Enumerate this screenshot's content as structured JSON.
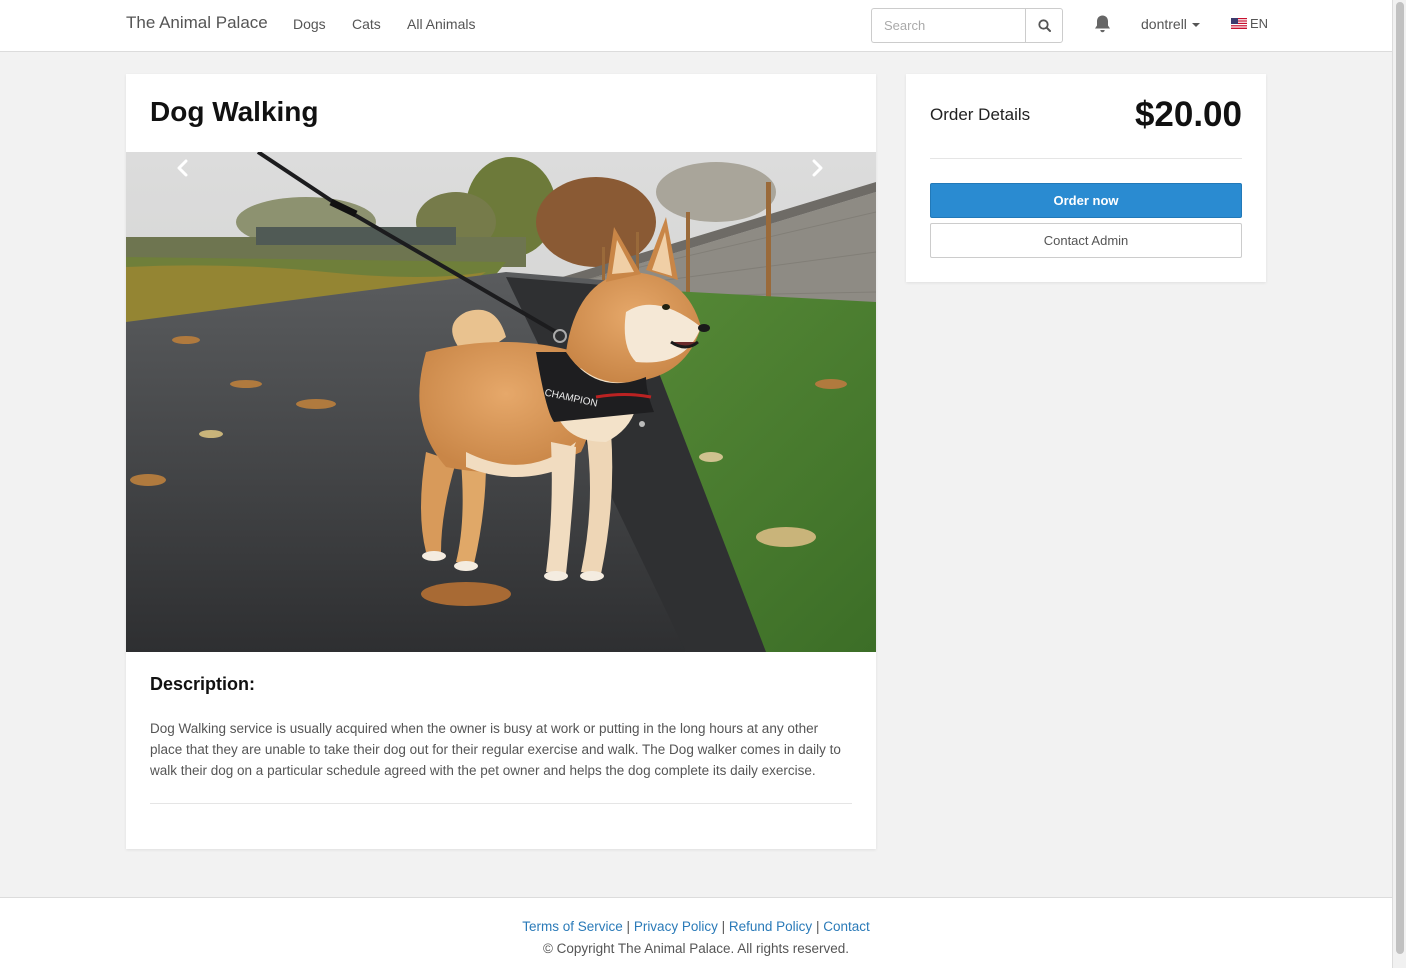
{
  "nav": {
    "brand": "The Animal Palace",
    "links": [
      "Dogs",
      "Cats",
      "All Animals"
    ],
    "search_placeholder": "Search",
    "username": "dontrell",
    "language": "EN"
  },
  "product": {
    "title": "Dog Walking",
    "image_alt": "Shiba Inu on a leash wearing a CHAMPION harness",
    "harness_text": "CHAMPION",
    "description_heading": "Description:",
    "description": "Dog Walking service is usually acquired when the owner is busy at work or putting in the long hours at any other place that they are unable to take their dog out for their regular exercise and walk. The Dog walker comes in daily to walk their dog on a particular schedule agreed with the pet owner and helps the dog complete its daily exercise."
  },
  "order": {
    "label": "Order Details",
    "price": "$20.00",
    "order_button": "Order now",
    "contact_button": "Contact Admin"
  },
  "footer": {
    "links": [
      "Terms of Service",
      "Privacy Policy",
      "Refund Policy",
      "Contact"
    ],
    "separator": "|",
    "copyright": "© Copyright The Animal Palace. All rights reserved."
  },
  "colors": {
    "primary": "#2a8bd1",
    "link": "#2a7ab8",
    "background": "#f2f2f2"
  },
  "icons": [
    "search-icon",
    "bell-icon",
    "chevron-left-icon",
    "chevron-right-icon",
    "us-flag-icon"
  ]
}
